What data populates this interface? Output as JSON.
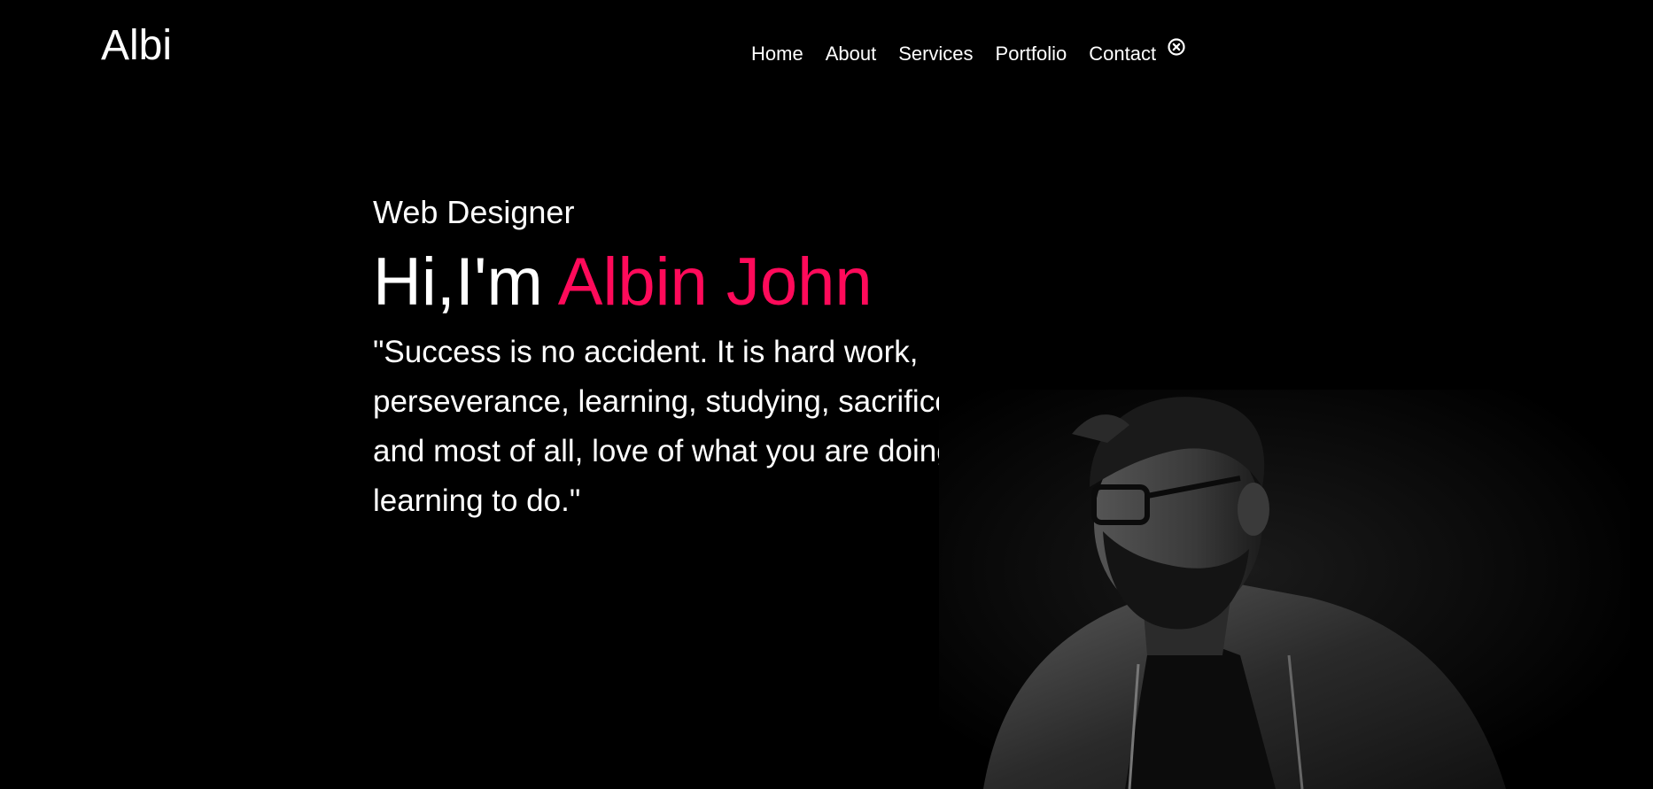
{
  "brand": {
    "logo": "Albi"
  },
  "nav": {
    "items": [
      "Home",
      "About",
      "Services",
      "Portfolio",
      "Contact"
    ],
    "close_icon": "close-circle-icon"
  },
  "hero": {
    "subtitle": "Web Designer",
    "greeting": "Hi,I'm",
    "name": "Albin John",
    "quote": "\"Success is no accident. It is hard work, perseverance, learning, studying, sacrifice and most of all, love of what you are doing or learning to do.\""
  },
  "colors": {
    "background": "#000000",
    "text": "#ffffff",
    "accent": "#ff0a5a"
  }
}
